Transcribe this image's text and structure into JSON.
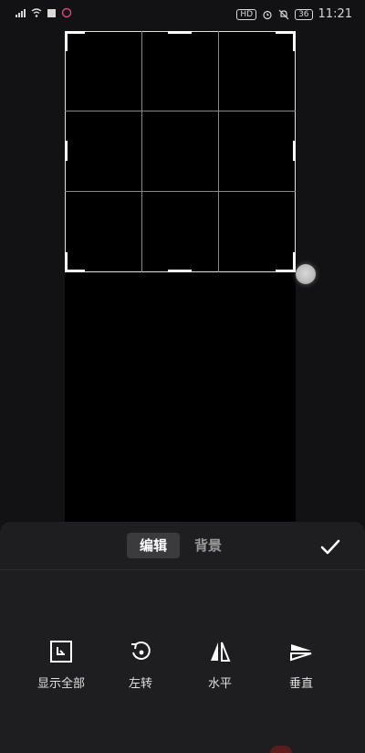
{
  "status_bar": {
    "left_icons": [
      "signal-icon",
      "wifi-icon",
      "square-icon",
      "app-icon"
    ],
    "hd_label": "HD",
    "battery": "36",
    "time": "11:21"
  },
  "tabs": [
    {
      "label": "编辑",
      "active": true
    },
    {
      "label": "背景",
      "active": false
    }
  ],
  "confirm_icon": "checkmark-icon",
  "tools": [
    {
      "label": "显示全部",
      "icon": "fit-all-icon"
    },
    {
      "label": "左转",
      "icon": "rotate-left-icon"
    },
    {
      "label": "水平",
      "icon": "flip-horizontal-icon"
    },
    {
      "label": "垂直",
      "icon": "flip-vertical-icon"
    }
  ],
  "colors": {
    "background": "#121214",
    "panel": "#1e1e20",
    "active_tab": "#3b3b3e",
    "canvas": "#000000"
  }
}
